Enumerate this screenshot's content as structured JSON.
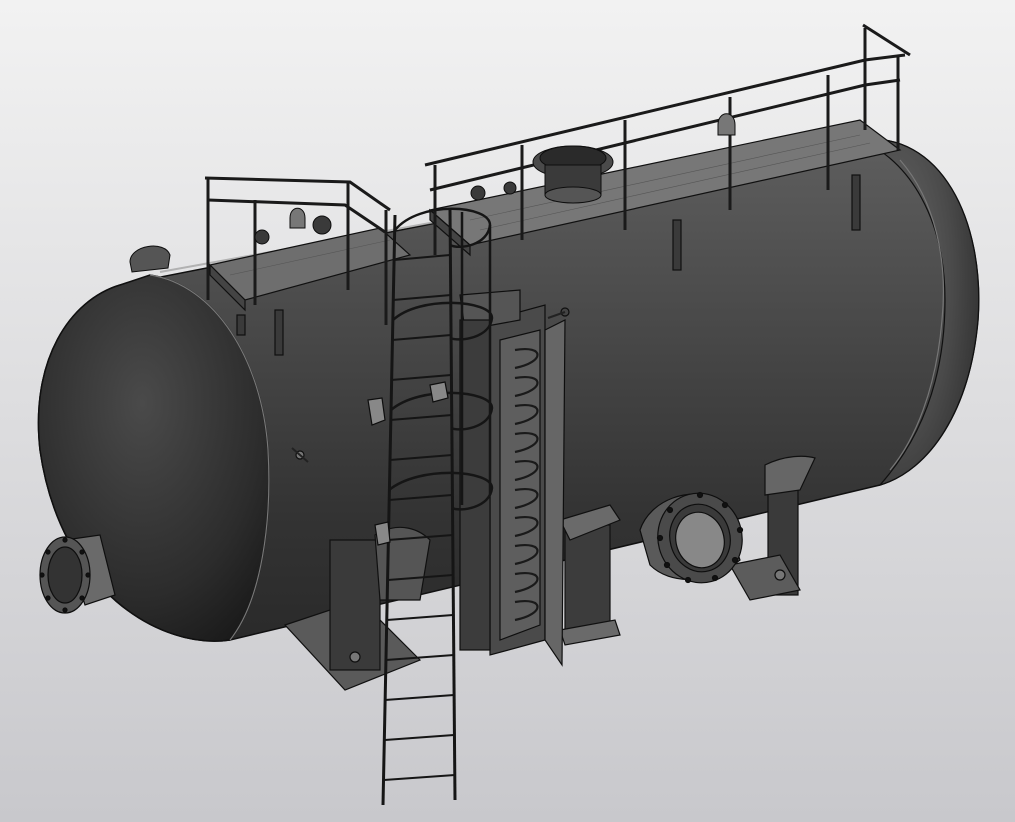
{
  "viewport": {
    "background_top": "#f2f2f2",
    "background_bottom": "#c8c8cc"
  },
  "model": {
    "subject": "horizontal-pressure-vessel-with-service-platform",
    "colors": {
      "shell_dark": "#2c2c2c",
      "shell_mid": "#5a5a5a",
      "shell_light": "#8a8a8a",
      "edge": "#0e0e0e",
      "highlight": "#b0b0b0"
    }
  }
}
